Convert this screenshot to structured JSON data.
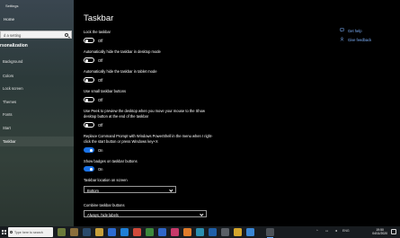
{
  "window": {
    "title": "Settings"
  },
  "sidebar": {
    "home_label": "Home",
    "search_placeholder": "d a setting",
    "section_label": "rsonalization",
    "items": [
      {
        "label": "Background"
      },
      {
        "label": "Colors"
      },
      {
        "label": "Lock screen"
      },
      {
        "label": "Themes"
      },
      {
        "label": "Fonts"
      },
      {
        "label": "Start"
      },
      {
        "label": "Taskbar"
      }
    ]
  },
  "main": {
    "title": "Taskbar",
    "settings": [
      {
        "label": "Lock the taskbar",
        "state_label": "Off",
        "on": false
      },
      {
        "label": "Automatically hide the taskbar in desktop mode",
        "state_label": "Off",
        "on": false
      },
      {
        "label": "Automatically hide the taskbar in tablet mode",
        "state_label": "Off",
        "on": false
      },
      {
        "label": "Use small taskbar buttons",
        "state_label": "Off",
        "on": false
      },
      {
        "label": "Use Peek to preview the desktop when you move your mouse to the Show desktop button at the end of the taskbar",
        "state_label": "Off",
        "on": false
      },
      {
        "label": "Replace Command Prompt with Windows PowerShell in the menu when I right-click the start button or press Windows key+X",
        "state_label": "On",
        "on": true
      },
      {
        "label": "Show badges on taskbar buttons",
        "state_label": "On",
        "on": true
      }
    ],
    "location": {
      "label": "Taskbar location on screen",
      "value": "Bottom"
    },
    "combine": {
      "label": "Combine taskbar buttons",
      "value": "Always, hide labels"
    }
  },
  "help": {
    "get_help": "Get help",
    "give_feedback": "Give feedback"
  },
  "taskbar": {
    "search_placeholder": "Type here to search",
    "tray_lang": "ENG",
    "time": "19:50",
    "date": "04/11/2020"
  },
  "colors": {
    "accent": "#1a73e8",
    "link": "#7fb3ff",
    "background": "#000000"
  }
}
